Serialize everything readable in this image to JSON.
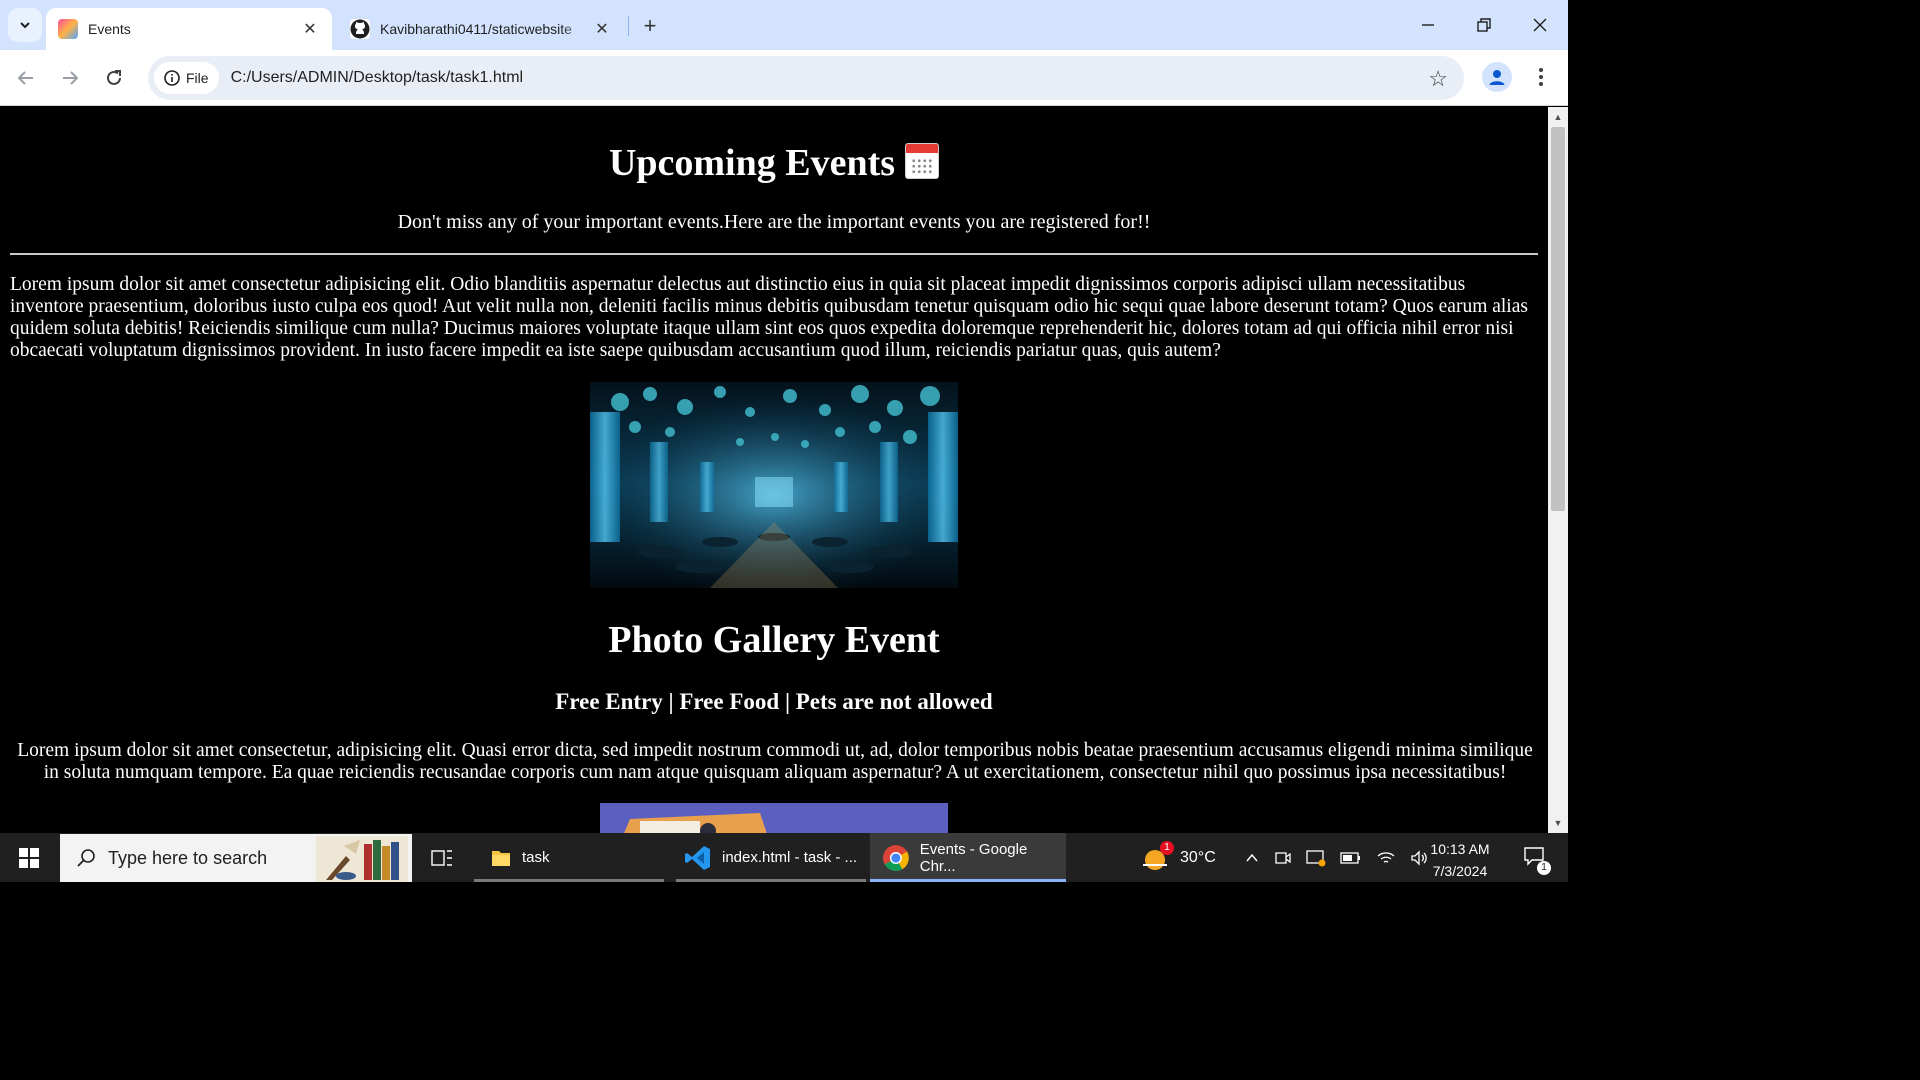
{
  "browser": {
    "tabs": [
      {
        "title": "Events",
        "active": true
      },
      {
        "title": "Kavibharathi0411/staticwebsite",
        "active": false
      }
    ],
    "address": {
      "chip_label": "File",
      "url": "C:/Users/ADMIN/Desktop/task/task1.html"
    }
  },
  "page": {
    "title": "Upcoming Events",
    "intro": "Don't miss any of your important events.Here are the important events you are registered for!!",
    "paragraph1": "Lorem ipsum dolor sit amet consectetur adipisicing elit. Odio blanditiis aspernatur delectus aut distinctio eius in quia sit placeat impedit dignissimos corporis adipisci ullam necessitatibus inventore praesentium, doloribus iusto culpa eos quod! Aut velit nulla non, deleniti facilis minus debitis quibusdam tenetur quisquam odio hic sequi quae labore deserunt totam? Quos earum alias quidem soluta debitis! Reiciendis similique cum nulla? Ducimus maiores voluptate itaque ullam sint eos quos expedita doloremque reprehenderit hic, dolores totam ad qui officia nihil error nisi obcaecati voluptatum dignissimos provident. In iusto facere impedit ea iste saepe quibusdam accusantium quod illum, reiciendis pariatur quas, quis autem?",
    "section_title": "Photo Gallery Event",
    "section_subtitle": "Free Entry | Free Food | Pets are not allowed",
    "paragraph2": "Lorem ipsum dolor sit amet consectetur, adipisicing elit. Quasi error dicta, sed impedit nostrum commodi ut, ad, dolor temporibus nobis beatae praesentium accusamus eligendi minima similique in soluta numquam tempore. Ea quae reiciendis recusandae corporis cum nam atque quisquam aliquam aspernatur? A ut exercitationem, consectetur nihil quo possimus ipsa necessitatibus!"
  },
  "taskbar": {
    "search_placeholder": "Type here to search",
    "apps": [
      {
        "label": "task"
      },
      {
        "label": "index.html - task - ..."
      },
      {
        "label": "Events - Google Chr..."
      }
    ],
    "weather": {
      "temp": "30°C",
      "badge": "1"
    },
    "time": "10:13 AM",
    "date": "7/3/2024",
    "notifications": "1"
  },
  "colors": {
    "tabstrip": "#d3e3fd",
    "page_bg": "#000000",
    "page_text": "#ffffff",
    "taskbar": "#202020"
  }
}
